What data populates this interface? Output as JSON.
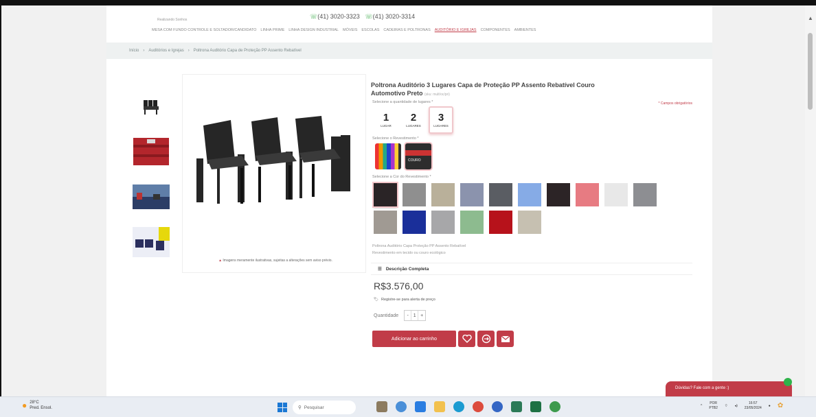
{
  "header": {
    "tagline": "Realizando Sonhos",
    "phones": [
      "(41) 3020-3323",
      "(41) 3020-3314"
    ],
    "nav": [
      {
        "label": "MESA COM FUNDO CONTROLE E SOLTADOR/CANDIDATO",
        "active": false
      },
      {
        "label": "LINHA PRIME",
        "active": false
      },
      {
        "label": "LINHA DESIGN INDUSTRIAL",
        "active": false
      },
      {
        "label": "MÓVEIS",
        "active": false
      },
      {
        "label": "ESCOLAS",
        "active": false
      },
      {
        "label": "CADEIRAS E POLTRONAS",
        "active": false
      },
      {
        "label": "AUDITÓRIO E IGREJAS",
        "active": true
      },
      {
        "label": "COMPONENTES",
        "active": false
      },
      {
        "label": "AMBIENTES",
        "active": false
      }
    ]
  },
  "breadcrumb": [
    "Início",
    "Auditórios e Igrejas",
    "Poltrona Auditório Capa de Proteção PP Assento Rebatível"
  ],
  "gallery": {
    "disclaimer_prefix": "▲",
    "disclaimer": "Imagens meramente ilustrativas, sujeitas a alterações sem aviso prévio."
  },
  "product": {
    "title": "Poltrona Auditório 3 Lugares Capa de Proteção PP Assento Rebatível Couro Automotivo Preto",
    "sku": "(sku: mult/oc/pri)",
    "required_note": "* Campos obrigatórios",
    "seats_label": "Selecione a quantidade de lugares *",
    "seats": [
      {
        "num": "1",
        "label": "LUGAR",
        "selected": false
      },
      {
        "num": "2",
        "label": "LUGARES",
        "selected": false
      },
      {
        "num": "3",
        "label": "LUGARES",
        "selected": true
      }
    ],
    "revestimento_label": "Selecione o Revestimento *",
    "revestimento_badge": "COURO",
    "color_label": "Selecione a Cor do Revestimento *",
    "colors": [
      "#2a2426",
      "#8f8f8f",
      "#b9b09a",
      "#8b93ad",
      "#5a5d63",
      "#86abe6",
      "#2c2426",
      "#e77b82",
      "#e8e8e8",
      "#8d8e92",
      "#a09a93",
      "#1a2f9a",
      "#a7a7a9",
      "#8dbb8f",
      "#b7121b",
      "#c6c0b1"
    ],
    "selected_color_index": 0,
    "short_desc": [
      "Poltrona Auditório Capa Proteção PP Assento Rebatível",
      "Revestimento em tecido ou couro ecológico"
    ],
    "full_desc_label": "Descrição Completa",
    "price": "R$3.576,00",
    "price_alert": "Registre-se para alerta de preço",
    "qty_label": "Quantidade",
    "qty_value": "1",
    "add_to_cart": "Adicionar ao carrinho"
  },
  "chat": {
    "label": "Dúvidas? Fale com a gente :)"
  },
  "taskbar": {
    "weather_temp": "28°C",
    "weather_desc": "Pred. Ensol.",
    "search_placeholder": "Pesquisar",
    "lang": "POR",
    "lang2": "PTB2",
    "time": "16:57",
    "date": "23/05/2024"
  }
}
